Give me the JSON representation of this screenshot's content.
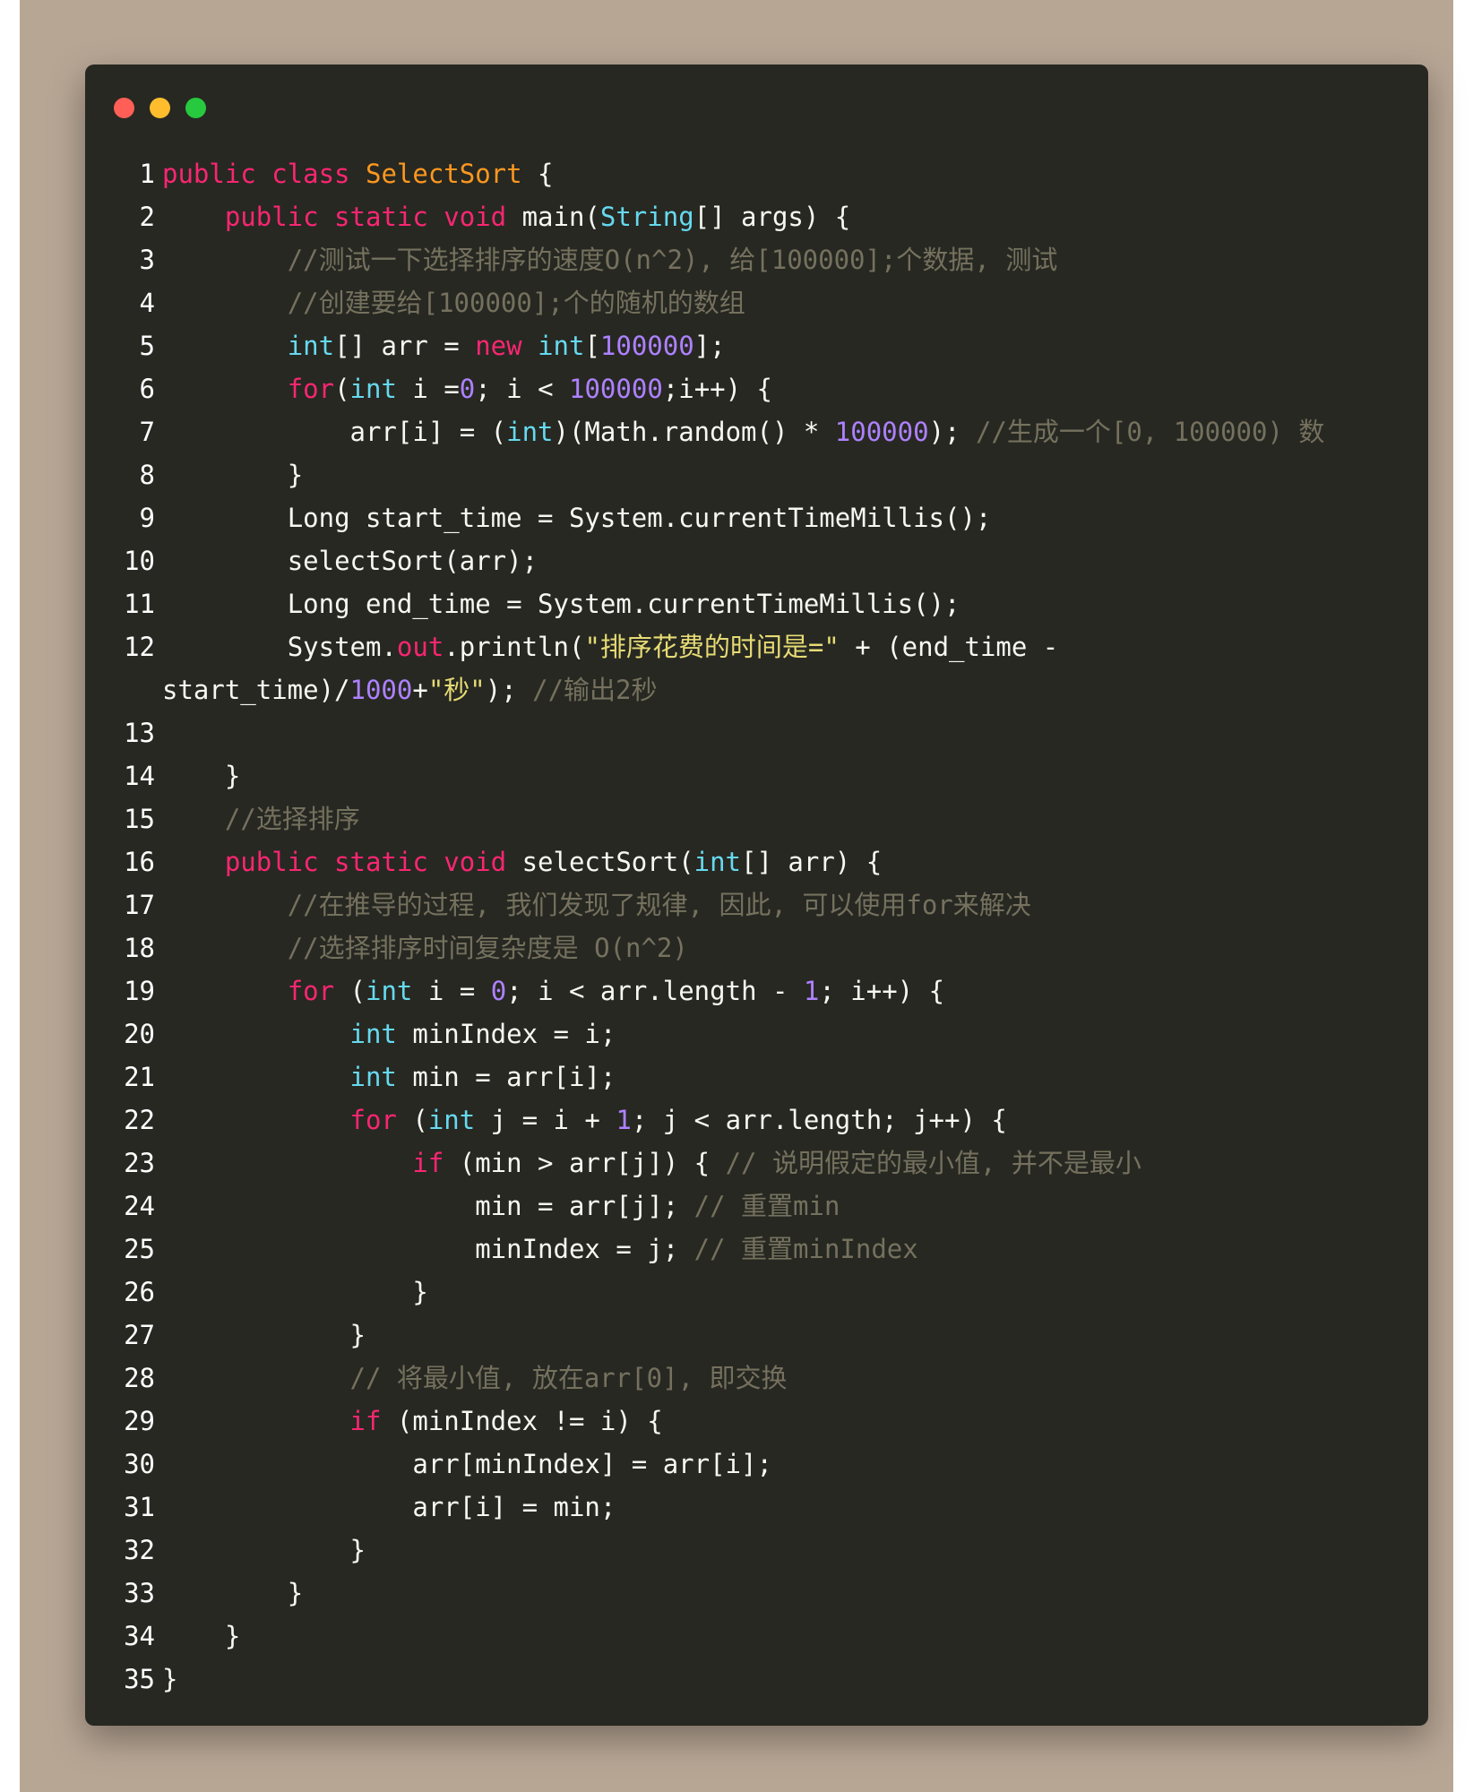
{
  "window": {
    "traffic_lights": [
      {
        "name": "close",
        "color": "#ff5f56"
      },
      {
        "name": "minimize",
        "color": "#ffbd2e"
      },
      {
        "name": "maximize",
        "color": "#27c93f"
      }
    ]
  },
  "colors": {
    "page_background": "#b8a695",
    "editor_background": "#272822",
    "keyword": "#f92672",
    "class_name": "#fd971f",
    "type": "#66d9ef",
    "number": "#ae81ff",
    "string": "#e6db74",
    "comment": "#75715e",
    "plain": "#f8f8f2"
  },
  "code": {
    "lines": [
      {
        "n": "1",
        "tokens": [
          [
            "kw",
            "public class "
          ],
          [
            "cls",
            "SelectSort"
          ],
          [
            "p",
            " {"
          ]
        ]
      },
      {
        "n": "2",
        "tokens": [
          [
            "p",
            "    "
          ],
          [
            "kw",
            "public static void "
          ],
          [
            "p",
            "main("
          ],
          [
            "type",
            "String"
          ],
          [
            "p",
            "[] args) {"
          ]
        ]
      },
      {
        "n": "3",
        "tokens": [
          [
            "p",
            "        "
          ],
          [
            "cmt",
            "//测试一下选择排序的速度O(n^2), 给[100000];个数据, 测试"
          ]
        ]
      },
      {
        "n": "4",
        "tokens": [
          [
            "p",
            "        "
          ],
          [
            "cmt",
            "//创建要给[100000];个的随机的数组"
          ]
        ]
      },
      {
        "n": "5",
        "tokens": [
          [
            "p",
            "        "
          ],
          [
            "type",
            "int"
          ],
          [
            "p",
            "[] arr = "
          ],
          [
            "kw",
            "new "
          ],
          [
            "type",
            "int"
          ],
          [
            "p",
            "["
          ],
          [
            "num",
            "100000"
          ],
          [
            "p",
            "];"
          ]
        ]
      },
      {
        "n": "6",
        "tokens": [
          [
            "p",
            "        "
          ],
          [
            "kw",
            "for"
          ],
          [
            "p",
            "("
          ],
          [
            "type",
            "int"
          ],
          [
            "p",
            " i ="
          ],
          [
            "num",
            "0"
          ],
          [
            "p",
            "; i < "
          ],
          [
            "num",
            "100000"
          ],
          [
            "p",
            ";i++) {"
          ]
        ]
      },
      {
        "n": "7",
        "tokens": [
          [
            "p",
            "            arr[i] = ("
          ],
          [
            "type",
            "int"
          ],
          [
            "p",
            ")(Math.random() * "
          ],
          [
            "num",
            "100000"
          ],
          [
            "p",
            "); "
          ],
          [
            "cmt",
            "//生成一个[0, 100000) 数"
          ]
        ]
      },
      {
        "n": "8",
        "tokens": [
          [
            "p",
            "        }"
          ]
        ]
      },
      {
        "n": "9",
        "tokens": [
          [
            "p",
            "        Long start_time = System.currentTimeMillis();"
          ]
        ]
      },
      {
        "n": "10",
        "tokens": [
          [
            "p",
            "        selectSort(arr);"
          ]
        ]
      },
      {
        "n": "11",
        "tokens": [
          [
            "p",
            "        Long end_time = System.currentTimeMillis();"
          ]
        ]
      },
      {
        "n": "12",
        "tokens": [
          [
            "p",
            "        System."
          ],
          [
            "kw",
            "out"
          ],
          [
            "p",
            ".println("
          ],
          [
            "str",
            "\"排序花费的时间是=\""
          ],
          [
            "p",
            " + (end_time -"
          ]
        ]
      },
      {
        "n": "",
        "tokens": [
          [
            "p",
            "start_time)/"
          ],
          [
            "num",
            "1000"
          ],
          [
            "p",
            "+"
          ],
          [
            "str",
            "\"秒\""
          ],
          [
            "p",
            "); "
          ],
          [
            "cmt",
            "//输出2秒"
          ]
        ]
      },
      {
        "n": "13",
        "tokens": [
          [
            "p",
            ""
          ]
        ]
      },
      {
        "n": "14",
        "tokens": [
          [
            "p",
            "    }"
          ]
        ]
      },
      {
        "n": "15",
        "tokens": [
          [
            "p",
            "    "
          ],
          [
            "cmt",
            "//选择排序"
          ]
        ]
      },
      {
        "n": "16",
        "tokens": [
          [
            "p",
            "    "
          ],
          [
            "kw",
            "public static void "
          ],
          [
            "p",
            "selectSort("
          ],
          [
            "type",
            "int"
          ],
          [
            "p",
            "[] arr) {"
          ]
        ]
      },
      {
        "n": "17",
        "tokens": [
          [
            "p",
            "        "
          ],
          [
            "cmt",
            "//在推导的过程, 我们发现了规律, 因此, 可以使用for来解决"
          ]
        ]
      },
      {
        "n": "18",
        "tokens": [
          [
            "p",
            "        "
          ],
          [
            "cmt",
            "//选择排序时间复杂度是 O(n^2)"
          ]
        ]
      },
      {
        "n": "19",
        "tokens": [
          [
            "p",
            "        "
          ],
          [
            "kw",
            "for"
          ],
          [
            "p",
            " ("
          ],
          [
            "type",
            "int"
          ],
          [
            "p",
            " i = "
          ],
          [
            "num",
            "0"
          ],
          [
            "p",
            "; i < arr.length - "
          ],
          [
            "num",
            "1"
          ],
          [
            "p",
            "; i++) {"
          ]
        ]
      },
      {
        "n": "20",
        "tokens": [
          [
            "p",
            "            "
          ],
          [
            "type",
            "int"
          ],
          [
            "p",
            " minIndex = i;"
          ]
        ]
      },
      {
        "n": "21",
        "tokens": [
          [
            "p",
            "            "
          ],
          [
            "type",
            "int"
          ],
          [
            "p",
            " min = arr[i];"
          ]
        ]
      },
      {
        "n": "22",
        "tokens": [
          [
            "p",
            "            "
          ],
          [
            "kw",
            "for"
          ],
          [
            "p",
            " ("
          ],
          [
            "type",
            "int"
          ],
          [
            "p",
            " j = i + "
          ],
          [
            "num",
            "1"
          ],
          [
            "p",
            "; j < arr.length; j++) {"
          ]
        ]
      },
      {
        "n": "23",
        "tokens": [
          [
            "p",
            "                "
          ],
          [
            "kw",
            "if"
          ],
          [
            "p",
            " (min > arr[j]) { "
          ],
          [
            "cmt",
            "// 说明假定的最小值, 并不是最小"
          ]
        ]
      },
      {
        "n": "24",
        "tokens": [
          [
            "p",
            "                    min = arr[j]; "
          ],
          [
            "cmt",
            "// 重置min"
          ]
        ]
      },
      {
        "n": "25",
        "tokens": [
          [
            "p",
            "                    minIndex = j; "
          ],
          [
            "cmt",
            "// 重置minIndex"
          ]
        ]
      },
      {
        "n": "26",
        "tokens": [
          [
            "p",
            "                }"
          ]
        ]
      },
      {
        "n": "27",
        "tokens": [
          [
            "p",
            "            }"
          ]
        ]
      },
      {
        "n": "28",
        "tokens": [
          [
            "p",
            "            "
          ],
          [
            "cmt",
            "// 将最小值, 放在arr[0], 即交换"
          ]
        ]
      },
      {
        "n": "29",
        "tokens": [
          [
            "p",
            "            "
          ],
          [
            "kw",
            "if"
          ],
          [
            "p",
            " (minIndex != i) {"
          ]
        ]
      },
      {
        "n": "30",
        "tokens": [
          [
            "p",
            "                arr[minIndex] = arr[i];"
          ]
        ]
      },
      {
        "n": "31",
        "tokens": [
          [
            "p",
            "                arr[i] = min;"
          ]
        ]
      },
      {
        "n": "32",
        "tokens": [
          [
            "p",
            "            }"
          ]
        ]
      },
      {
        "n": "33",
        "tokens": [
          [
            "p",
            "        }"
          ]
        ]
      },
      {
        "n": "34",
        "tokens": [
          [
            "p",
            "    }"
          ]
        ]
      },
      {
        "n": "35",
        "tokens": [
          [
            "p",
            "}"
          ]
        ]
      }
    ]
  }
}
